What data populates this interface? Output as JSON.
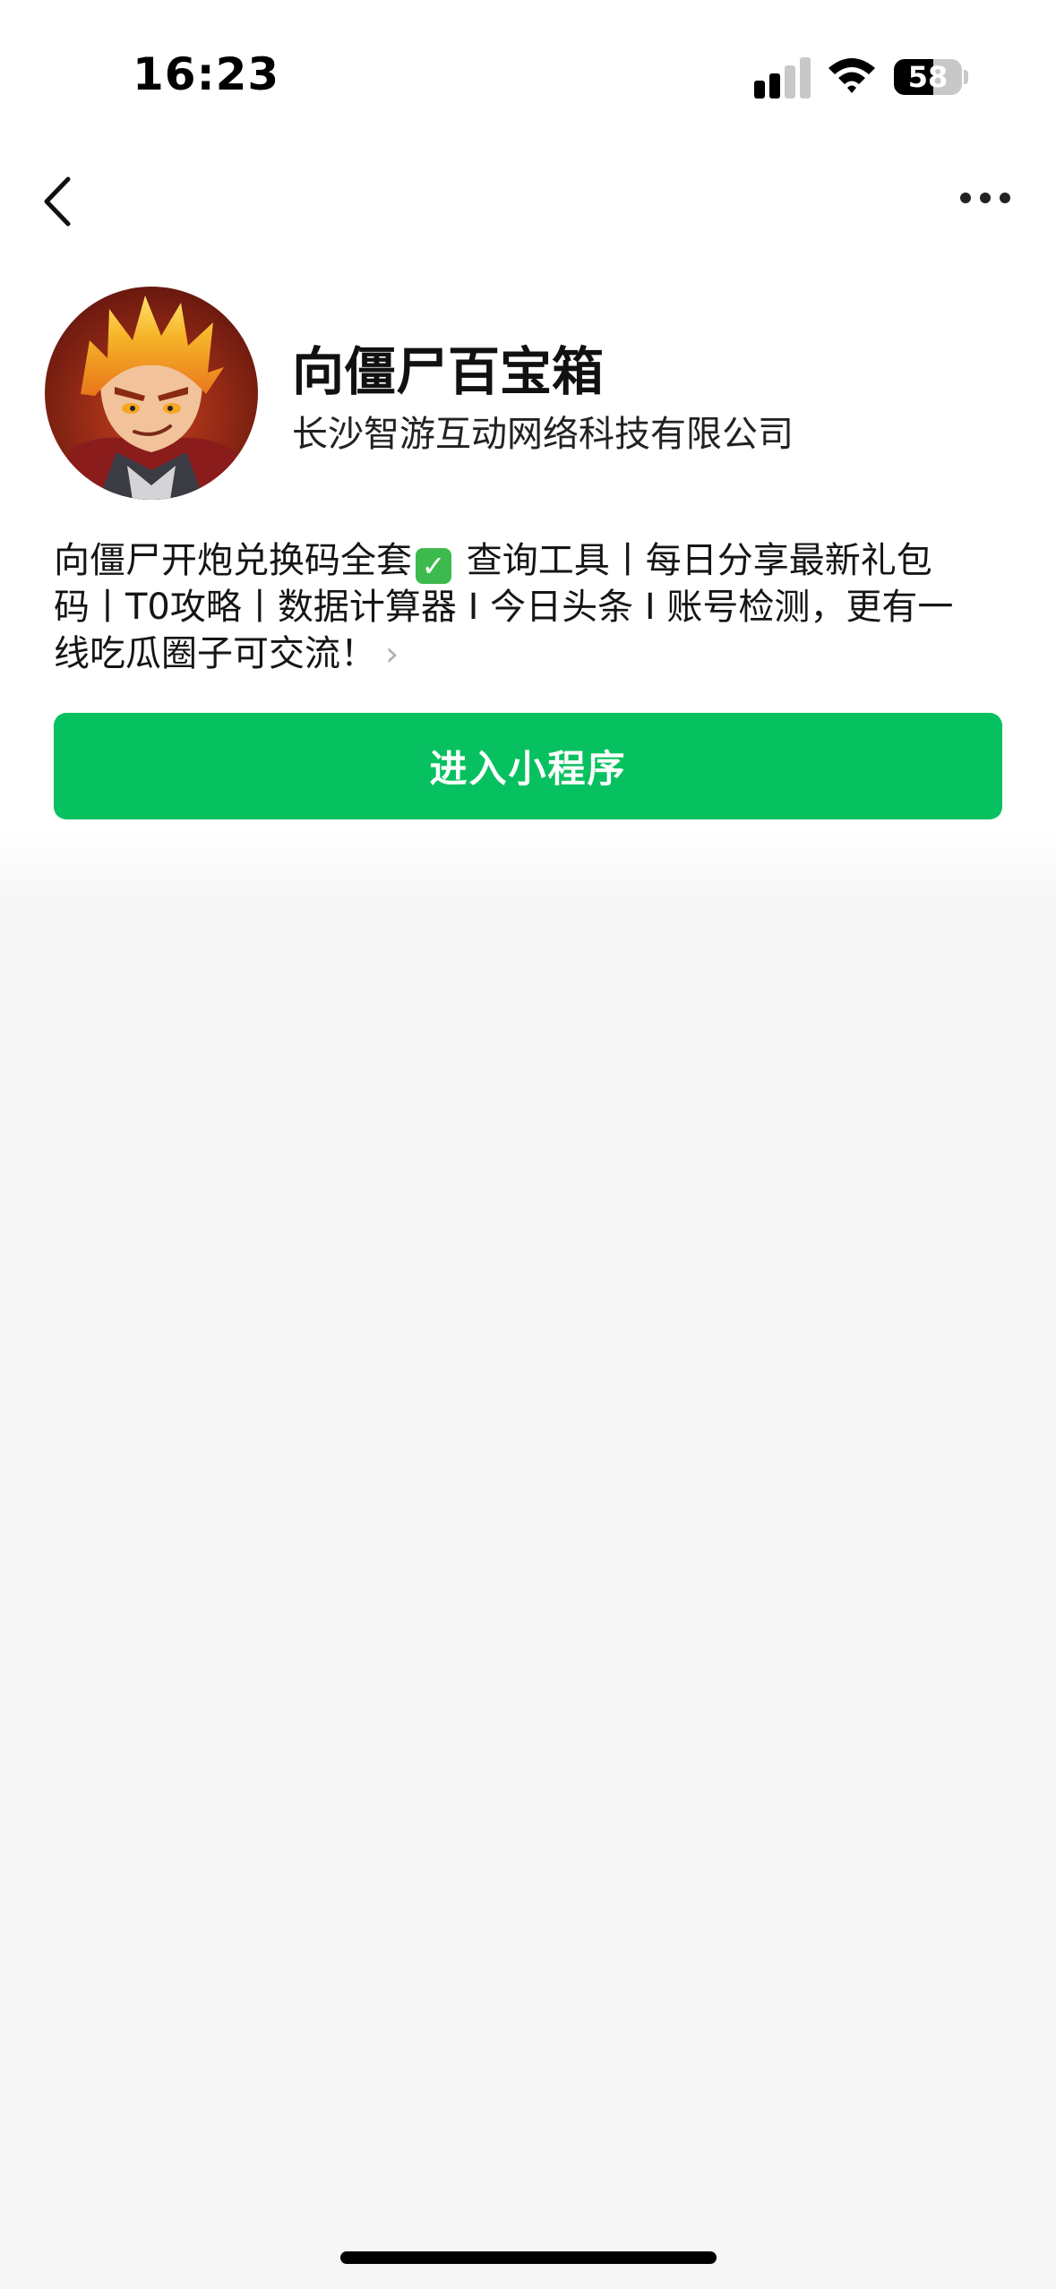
{
  "status_bar": {
    "time": "16:23",
    "battery_level": "58",
    "battery_fraction": 0.58,
    "icons": [
      "cellular-signal-icon",
      "wifi-icon",
      "battery-icon"
    ]
  },
  "nav": {
    "back_icon": "chevron-left-icon",
    "more_icon": "more-dots-icon"
  },
  "profile": {
    "name": "向僵尸百宝箱",
    "company": "长沙智游互动网络科技有限公司",
    "description_lines": [
      "向僵尸开炮兑换码全套",
      " 查询工具丨每日分享最新礼包",
      "码丨T0攻略丨数据计算器 I 今日头条 I 账号检测，更有一",
      "线吃瓜圈子可交流！"
    ],
    "check_emoji": "✓",
    "chevron": "›"
  },
  "actions": {
    "enter_label": "进入小程序"
  },
  "colors": {
    "accent_green": "#07c160",
    "background": "#f6f6f6",
    "panel": "#ffffff"
  }
}
